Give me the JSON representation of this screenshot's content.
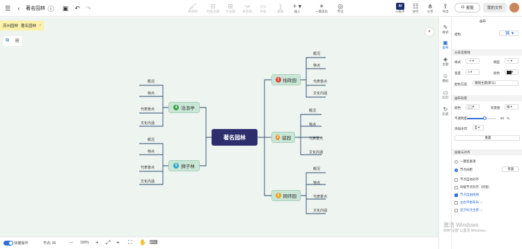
{
  "header": {
    "title": "著名园林",
    "toolbar": [
      {
        "icon": "format-painter-icon",
        "label": "格式刷"
      },
      {
        "icon": "sibling-topic-icon",
        "label": "同级主题"
      },
      {
        "icon": "child-topic-icon",
        "label": "子主题"
      },
      {
        "icon": "relation-icon",
        "label": "关系线"
      },
      {
        "icon": "summary-icon",
        "label": "外框"
      },
      {
        "icon": "outline-icon",
        "label": "概要"
      },
      {
        "icon": "insert-icon",
        "label": "插入"
      },
      {
        "icon": "beautify-icon",
        "label": "一键美化"
      },
      {
        "icon": "focus-icon",
        "label": "专注"
      }
    ],
    "right_tools": [
      {
        "icon": "ai-icon",
        "label": "AI助手",
        "badge": "AI"
      },
      {
        "icon": "collab-icon",
        "label": "协作"
      },
      {
        "icon": "share-icon",
        "label": "分享"
      },
      {
        "icon": "export-icon",
        "label": "导出"
      }
    ],
    "share_label": "客服",
    "my_files_label": "我的文件"
  },
  "breadcrumb": {
    "items": [
      "苏州园林",
      "著名园林"
    ],
    "close": "×"
  },
  "mindmap": {
    "root": "著名园林",
    "branches": [
      {
        "num": "1",
        "label": "拙政园",
        "color": "#e0453a",
        "leaves": [
          "概况",
          "特点",
          "代表景点",
          "文化内涵"
        ]
      },
      {
        "num": "2",
        "label": "留园",
        "color": "#f08a24",
        "leaves": [
          "概况",
          "特点",
          "代表景点",
          "文化内涵"
        ]
      },
      {
        "num": "3",
        "label": "网师园",
        "color": "#f0a21c",
        "leaves": [
          "概况",
          "特点",
          "代表景点",
          "文化内涵"
        ]
      },
      {
        "num": "4",
        "label": "沧浪亭",
        "color": "#3fa34d",
        "leaves": [
          "概况",
          "特点",
          "代表景点",
          "文化内涵"
        ]
      },
      {
        "num": "5",
        "label": "狮子林",
        "color": "#2fa7c9",
        "leaves": [
          "概况",
          "特点",
          "代表景点",
          "文化内涵"
        ]
      }
    ]
  },
  "bottombar": {
    "quick_label": "快捷操作",
    "nodes_label": "节点: 26",
    "zoom": "100%",
    "zoom_out": "—",
    "zoom_in": "+"
  },
  "sidetabs": [
    {
      "icon": "style-icon",
      "label": "样式"
    },
    {
      "icon": "canvas-icon",
      "label": "画布"
    },
    {
      "icon": "theme-icon",
      "label": "主题"
    },
    {
      "icon": "icons-icon",
      "label": "图标"
    },
    {
      "icon": "slides-icon",
      "label": "幻灯"
    },
    {
      "icon": "history-icon",
      "label": "历史"
    }
  ],
  "panel": {
    "title": "画布",
    "structure_label": "结构",
    "branch_section": "分支连接线",
    "style_label": "样式",
    "line_end_label": "端型",
    "width_label": "宽度",
    "color_label": "颜色",
    "color_scheme_label": "配色方案",
    "color_scheme_value": "跟随主题(默认)",
    "bg_section": "画布背景",
    "bg_color_label": "颜色",
    "bg_image_label": "背景图",
    "opacity_label": "不透明度",
    "opacity_value": "60",
    "opacity_unit": "%",
    "add_watermark_label": "添加水印",
    "reset_label": "重置",
    "layout_section": "层级与对齐",
    "opt_auto": "一键变紧凑",
    "opt_node_spacing": "节点间距",
    "restore_label": "恢复",
    "opt_node_align": "节点自动对齐",
    "opt_same_width": "同级节点对齐（同宽）",
    "opt_branch_free": "节点自由拖拽",
    "opt_balance": "左右平衡布局",
    "opt_theme_shape": "显示标注主题"
  },
  "watermark": {
    "line1": "激活 Windows",
    "line2": "转到“设置”以激活 Windows。"
  }
}
